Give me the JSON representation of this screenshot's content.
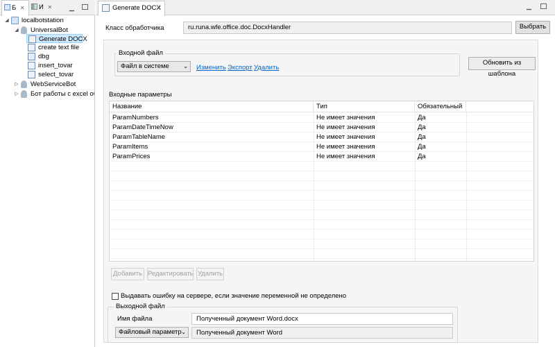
{
  "left_tabs": [
    {
      "label": "Б"
    },
    {
      "label": "И"
    }
  ],
  "tree": {
    "root": "localbotstation",
    "bot": "UniversalBot",
    "tasks": [
      "Generate DOCX",
      "create text file",
      "dbg",
      "insert_tovar",
      "select_tovar"
    ],
    "others": [
      "WebServiceBot",
      "Бот работы с excel объ"
    ]
  },
  "editor_tab": {
    "label": "Generate DOCX"
  },
  "handler": {
    "label": "Класс обработчика",
    "value": "ru.runa.wfe.office.doc.DocxHandler",
    "choose_btn": "Выбрать"
  },
  "input_file": {
    "group_label": "Входной файл",
    "source": "Файл в системе",
    "links": [
      "Изменить",
      "Экспорт",
      "Удалить"
    ],
    "update_btn": "Обновить из шаблона"
  },
  "params": {
    "title": "Входные параметры",
    "columns": [
      "Название",
      "Тип",
      "Обязательный"
    ],
    "rows": [
      [
        "ParamNumbers",
        "Не имеет значения",
        "Да"
      ],
      [
        "ParamDateTimeNow",
        "Не имеет значения",
        "Да"
      ],
      [
        "ParamTableName",
        "Не имеет значения",
        "Да"
      ],
      [
        "ParamItems",
        "Не имеет значения",
        "Да"
      ],
      [
        "ParamPrices",
        "Не имеет значения",
        "Да"
      ]
    ],
    "buttons": [
      "Добавить",
      "Редактировать",
      "Удалить"
    ]
  },
  "error_checkbox": {
    "label": "Выдавать ошибку на сервере, если значение переменной не определено",
    "checked": false
  },
  "output_file": {
    "group_label": "Выходной файл",
    "name_label": "Имя файла",
    "name_value": "Полученный документ Word.docx",
    "param_select": "Файловый параметр",
    "param_value": "Полученный документ Word"
  },
  "colors": {
    "link": "#0066cc",
    "selection": "#cde8ff"
  }
}
